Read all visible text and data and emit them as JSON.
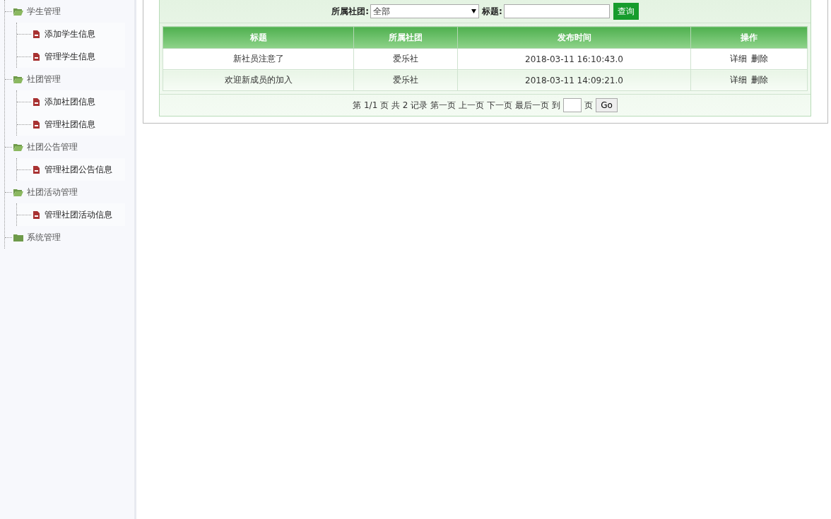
{
  "sidebar": {
    "tree": [
      {
        "label": "学生管理",
        "expanded": true,
        "children": [
          {
            "label": "添加学生信息"
          },
          {
            "label": "管理学生信息"
          }
        ]
      },
      {
        "label": "社团管理",
        "expanded": true,
        "children": [
          {
            "label": "添加社团信息"
          },
          {
            "label": "管理社团信息"
          }
        ]
      },
      {
        "label": "社团公告管理",
        "expanded": true,
        "children": [
          {
            "label": "管理社团公告信息"
          }
        ]
      },
      {
        "label": "社团活动管理",
        "expanded": true,
        "children": [
          {
            "label": "管理社团活动信息"
          }
        ]
      },
      {
        "label": "系统管理",
        "expanded": false
      }
    ]
  },
  "filter": {
    "club_label": "所属社团:",
    "club_value": "全部",
    "title_label": "标题:",
    "search_button": "查询"
  },
  "table": {
    "columns": [
      "标题",
      "所属社团",
      "发布时间",
      "操作"
    ],
    "rows": [
      {
        "title": "新社员注意了",
        "club": "爱乐社",
        "time": "2018-03-11 16:10:43.0",
        "actions": [
          "详细",
          "删除"
        ]
      },
      {
        "title": "欢迎新成员的加入",
        "club": "爱乐社",
        "time": "2018-03-11 14:09:21.0",
        "actions": [
          "详细",
          "删除"
        ]
      }
    ]
  },
  "pager": {
    "info": "第 1/1 页 共 2 记录",
    "links": [
      "第一页",
      "上一页",
      "下一页",
      "最后一页"
    ],
    "goto_label": "到",
    "page_suffix": "页",
    "go_button": "Go"
  }
}
